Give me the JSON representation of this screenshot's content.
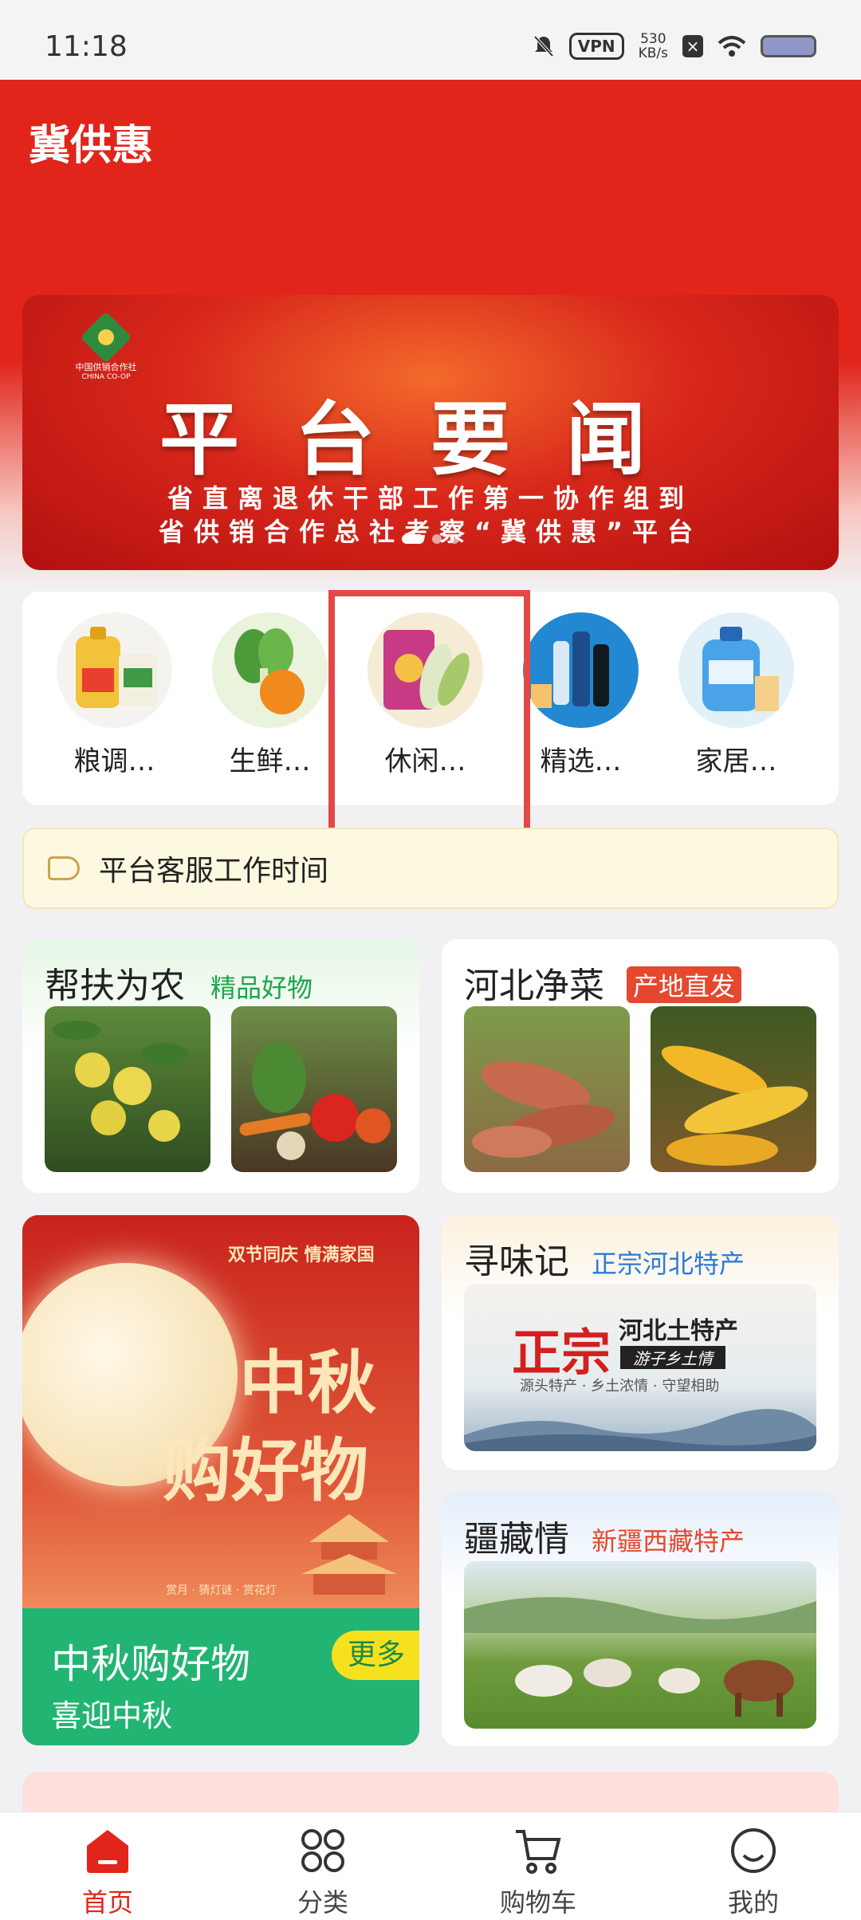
{
  "status_bar": {
    "time": "11:18",
    "vpn": "VPN",
    "speed_value": "530",
    "speed_unit": "KB/s"
  },
  "header": {
    "title": "冀供惠"
  },
  "banner": {
    "logo_text": "中国供销合作社",
    "logo_subtext": "CHINA CO-OP",
    "title": "平台要闻",
    "line1": "省直离退休干部工作第一协作组到",
    "line2": "省供销合作总社考察“冀供惠”平台"
  },
  "categories": [
    {
      "label": "粮调…",
      "icon": "oil-rice-icon"
    },
    {
      "label": "生鲜…",
      "icon": "vegetable-icon"
    },
    {
      "label": "休闲…",
      "icon": "snack-icon"
    },
    {
      "label": "精选…",
      "icon": "liquor-icon"
    },
    {
      "label": "家居…",
      "icon": "detergent-icon"
    }
  ],
  "notice": {
    "text": "平台客服工作时间"
  },
  "cards": {
    "help_farmers": {
      "title": "帮扶为农",
      "tag": "精品好物"
    },
    "hebei_veg": {
      "title": "河北净菜",
      "tag": "产地直发"
    },
    "xunweiji": {
      "title": "寻味记",
      "tag": "正宗河北特产",
      "banner_big": "正宗",
      "banner_title": "河北土特产",
      "banner_slogan": "游子乡土情",
      "banner_sub": "源头特产 · 乡土浓情 · 守望相助"
    },
    "xinjiang": {
      "title": "疆藏情",
      "tag": "新疆西藏特产"
    },
    "mid_autumn": {
      "top_text": "双节同庆 情满家国",
      "big1": "中秋",
      "big2": "购好物",
      "small": "赏月 · 猜灯谜 · 赏花灯",
      "title": "中秋购好物",
      "subtitle": "喜迎中秋",
      "more": "更多"
    }
  },
  "bottom_nav": [
    {
      "label": "首页",
      "icon": "home-icon",
      "active": true
    },
    {
      "label": "分类",
      "icon": "category-icon",
      "active": false
    },
    {
      "label": "购物车",
      "icon": "cart-icon",
      "active": false
    },
    {
      "label": "我的",
      "icon": "profile-icon",
      "active": false
    }
  ],
  "colors": {
    "brand_red": "#e1251b",
    "green": "#22b472",
    "tag_green": "#1aa64a",
    "tag_blue": "#2c7bd6",
    "tag_red": "#e5482e"
  }
}
